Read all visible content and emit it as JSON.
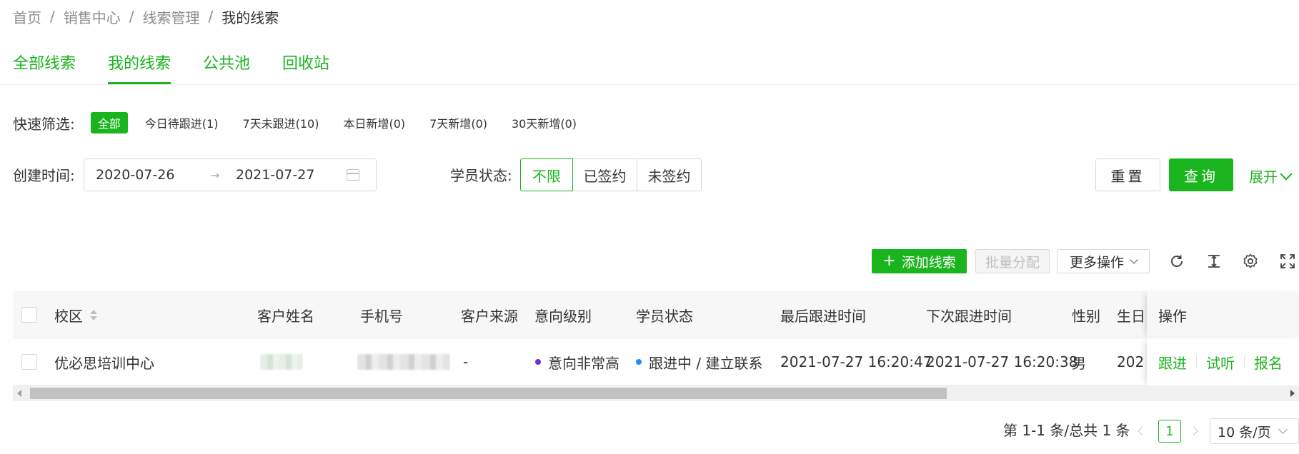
{
  "breadcrumb": {
    "items": [
      "首页",
      "销售中心",
      "线索管理"
    ],
    "current": "我的线索",
    "separator": "/"
  },
  "tabs": [
    {
      "label": "全部线索",
      "active": false
    },
    {
      "label": "我的线索",
      "active": true
    },
    {
      "label": "公共池",
      "active": false
    },
    {
      "label": "回收站",
      "active": false
    }
  ],
  "quick_filter": {
    "label": "快速筛选:",
    "chips": [
      "全部",
      "今日待跟进(1)",
      "7天未跟进(10)",
      "本日新增(0)",
      "7天新增(0)",
      "30天新增(0)"
    ],
    "active": "全部"
  },
  "create_time": {
    "label": "创建时间:",
    "start": "2020-07-26",
    "end": "2021-07-27",
    "arrow": "→",
    "icon": "calendar-icon"
  },
  "student_status": {
    "label": "学员状态:",
    "options": [
      "不限",
      "已签约",
      "未签约"
    ],
    "selected": "不限"
  },
  "actions": {
    "reset": "重置",
    "query": "查询",
    "expand": "展开"
  },
  "toolbar": {
    "add": "添加线索",
    "add_icon": "+",
    "batch": "批量分配",
    "more": "更多操作",
    "icons": [
      "refresh-icon",
      "column-height-icon",
      "settings-icon",
      "fullscreen-icon"
    ]
  },
  "table": {
    "columns": [
      "校区",
      "客户姓名",
      "手机号",
      "客户来源",
      "意向级别",
      "学员状态",
      "最后跟进时间",
      "下次跟进时间",
      "性别",
      "生日",
      "操作"
    ],
    "rows": [
      {
        "campus": "优必思培训中心",
        "source": "-",
        "intent": "意向非常高",
        "status": "跟进中 / 建立联系",
        "last_follow": "2021-07-27 16:20:47",
        "next_follow": "2021-07-27 16:20:38",
        "gender": "男",
        "birthday": "202",
        "ops": [
          "跟进",
          "试听",
          "报名"
        ]
      }
    ]
  },
  "pagination": {
    "total_text": "第 1-1 条/总共 1 条",
    "current_page": "1",
    "page_size": "10 条/页"
  },
  "colors": {
    "primary": "#1ab41e",
    "intent_dot": "#722ed1",
    "status_dot": "#1890ff"
  }
}
